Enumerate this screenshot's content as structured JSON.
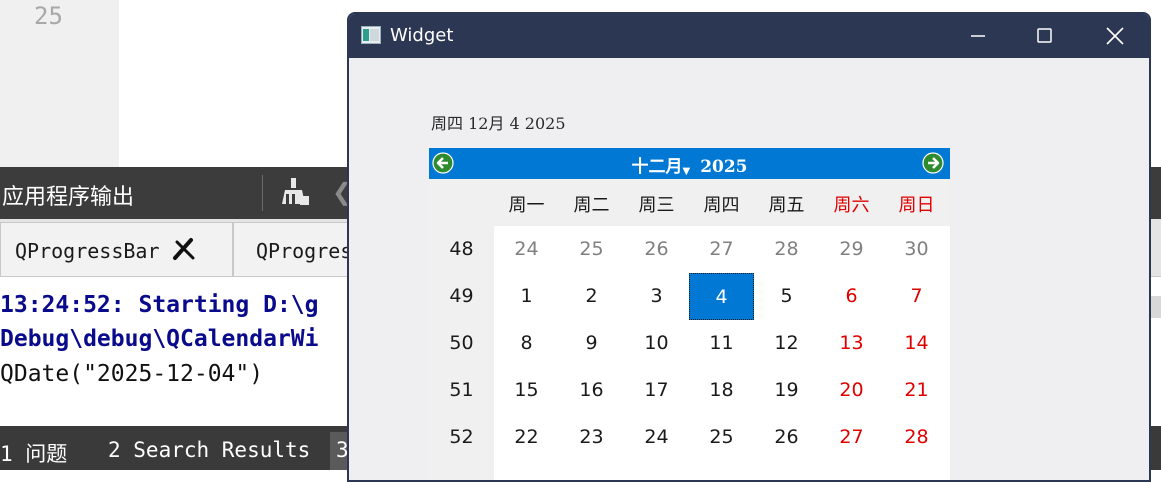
{
  "editor": {
    "line_number": "25"
  },
  "output_panel": {
    "title": "应用程序输出",
    "tabs": [
      {
        "label": "QProgressBar"
      },
      {
        "label": "QProgres"
      }
    ],
    "console": [
      {
        "text": "13:24:52: Starting D:\\g",
        "style": "bold"
      },
      {
        "text": "Debug\\debug\\QCalendarWi",
        "style": "bold"
      },
      {
        "text": "QDate(\"2025-12-04\")",
        "style": "normal"
      }
    ]
  },
  "status_bar": {
    "items": [
      {
        "label": "1 问题"
      },
      {
        "label": "2 Search Results"
      },
      {
        "label": "3"
      }
    ]
  },
  "window": {
    "title": "Widget",
    "date_label": "周四 12月 4 2025",
    "calendar": {
      "month": "十二月",
      "year": "2025",
      "weekdays": [
        "周一",
        "周二",
        "周三",
        "周四",
        "周五",
        "周六",
        "周日"
      ],
      "weeks": [
        {
          "num": "48",
          "days": [
            "24",
            "25",
            "26",
            "27",
            "28",
            "29",
            "30"
          ]
        },
        {
          "num": "49",
          "days": [
            "1",
            "2",
            "3",
            "4",
            "5",
            "6",
            "7"
          ]
        },
        {
          "num": "50",
          "days": [
            "8",
            "9",
            "10",
            "11",
            "12",
            "13",
            "14"
          ]
        },
        {
          "num": "51",
          "days": [
            "15",
            "16",
            "17",
            "18",
            "19",
            "20",
            "21"
          ]
        },
        {
          "num": "52",
          "days": [
            "22",
            "23",
            "24",
            "25",
            "26",
            "27",
            "28"
          ]
        }
      ],
      "selected_day": "4",
      "colors": {
        "accent": "#0078d4",
        "weekend": "#e00000",
        "other_month": "#808080"
      }
    }
  }
}
